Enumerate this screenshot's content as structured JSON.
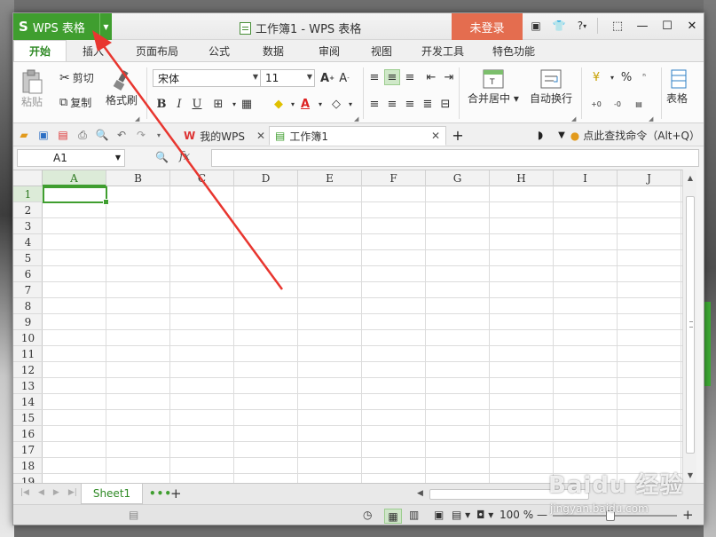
{
  "app": {
    "logo": "S",
    "name": "WPS 表格",
    "window_title": "工作簿1 - WPS 表格",
    "login": "未登录",
    "help": "?"
  },
  "ribbon_tabs": [
    "开始",
    "插入",
    "页面布局",
    "公式",
    "数据",
    "审阅",
    "视图",
    "开发工具",
    "特色功能"
  ],
  "ribbon": {
    "paste": "粘贴",
    "cut": "剪切",
    "copy": "复制",
    "format_painter": "格式刷",
    "font_name": "宋体",
    "font_size": "11",
    "bold": "B",
    "italic": "I",
    "underline": "U",
    "merge_center": "合并居中",
    "wrap_text": "自动换行",
    "percent": "%",
    "table_style": "表格"
  },
  "doc_tabs": [
    {
      "label": "我的WPS"
    },
    {
      "label": "工作簿1"
    }
  ],
  "command_search": "点此查找命令（Alt+Q）",
  "formula_bar": {
    "name_box": "A1",
    "fx": "fx"
  },
  "columns": [
    "A",
    "B",
    "C",
    "D",
    "E",
    "F",
    "G",
    "H",
    "I",
    "J"
  ],
  "rows": [
    "1",
    "2",
    "3",
    "4",
    "5",
    "6",
    "7",
    "8",
    "9",
    "10",
    "11",
    "12",
    "13",
    "14",
    "15",
    "16",
    "17",
    "18",
    "19"
  ],
  "sheets": [
    "Sheet1"
  ],
  "status": {
    "zoom": "100 %"
  },
  "watermark": {
    "brand": "Baidu 经验",
    "url": "jingyan.baidu.com"
  },
  "colors": {
    "accent": "#3f9e2f",
    "login": "#e46d4f",
    "annotation": "#e8362f"
  }
}
